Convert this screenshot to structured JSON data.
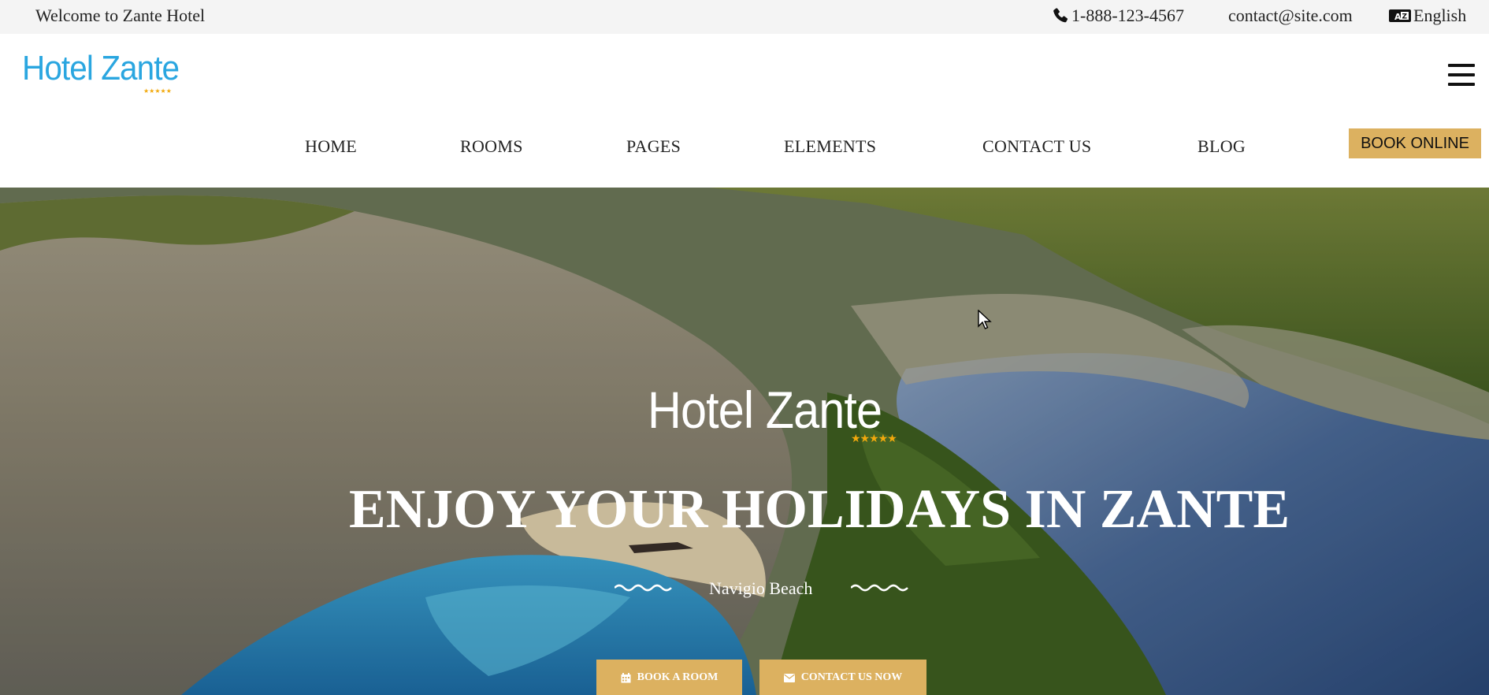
{
  "topbar": {
    "welcome": "Welcome to Zante Hotel",
    "phone": "1-888-123-4567",
    "email": "contact@site.com",
    "language": "English"
  },
  "logo": {
    "name": "Hotel Zante",
    "stars": "★★★★★"
  },
  "nav": {
    "items": [
      {
        "label": "HOME"
      },
      {
        "label": "ROOMS"
      },
      {
        "label": "PAGES"
      },
      {
        "label": "ELEMENTS"
      },
      {
        "label": "CONTACT US"
      },
      {
        "label": "BLOG"
      }
    ],
    "book_online": "BOOK ONLINE"
  },
  "hero": {
    "logo_name": "Hotel Zante",
    "logo_stars": "★★★★★",
    "title": "ENJOY YOUR HOLIDAYS IN ZANTE",
    "subtitle": "Navigio Beach",
    "buttons": {
      "book_room": "BOOK A ROOM",
      "contact": "CONTACT US NOW"
    }
  },
  "colors": {
    "accent": "#dcb160",
    "logo_blue": "#2aa6e0",
    "stars": "#f2a90c",
    "topbar_bg": "#f4f4f4"
  },
  "icons": [
    "phone-icon",
    "language-card-icon",
    "hamburger-menu-icon",
    "calendar-icon",
    "envelope-icon",
    "mouse-cursor-icon"
  ]
}
